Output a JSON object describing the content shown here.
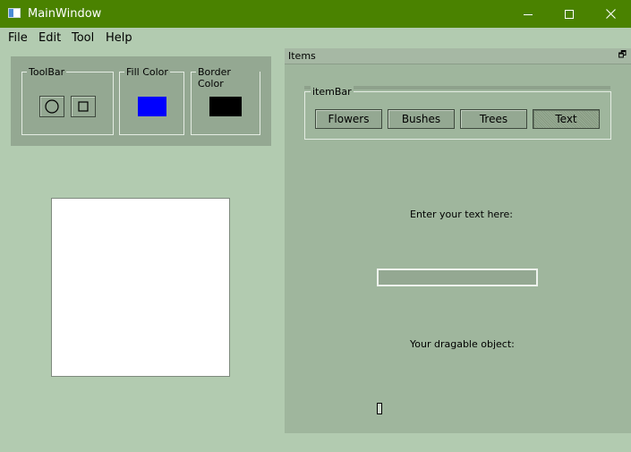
{
  "window": {
    "title": "MainWindow",
    "minimize_glyph": "—",
    "maximize_glyph": "☐",
    "close_glyph": "✕"
  },
  "menu": [
    "File",
    "Edit",
    "Tool",
    "Help"
  ],
  "toolbar": {
    "title": "ToolBar",
    "tools": [
      {
        "name": "ellipse-tool",
        "icon": "circle-icon"
      },
      {
        "name": "rectangle-tool",
        "icon": "square-icon"
      }
    ]
  },
  "fill_color": {
    "title": "Fill Color",
    "color": "#0000ff"
  },
  "border_color": {
    "title": "Border Color",
    "color": "#000000"
  },
  "items_dock": {
    "title": "Items",
    "float_glyph": "🗗",
    "itembar_title": "itemBar",
    "buttons": [
      "Flowers",
      "Bushes",
      "Trees",
      "Text"
    ],
    "active_button": "Text",
    "text_prompt": "Enter your text here:",
    "text_value": "",
    "drag_label": "Your dragable object:"
  },
  "colors": {
    "titlebar": "#4a8200",
    "window_bg": "#b2cbb0",
    "panel_bg": "#94a892",
    "dock_bg": "#9fb69d"
  }
}
